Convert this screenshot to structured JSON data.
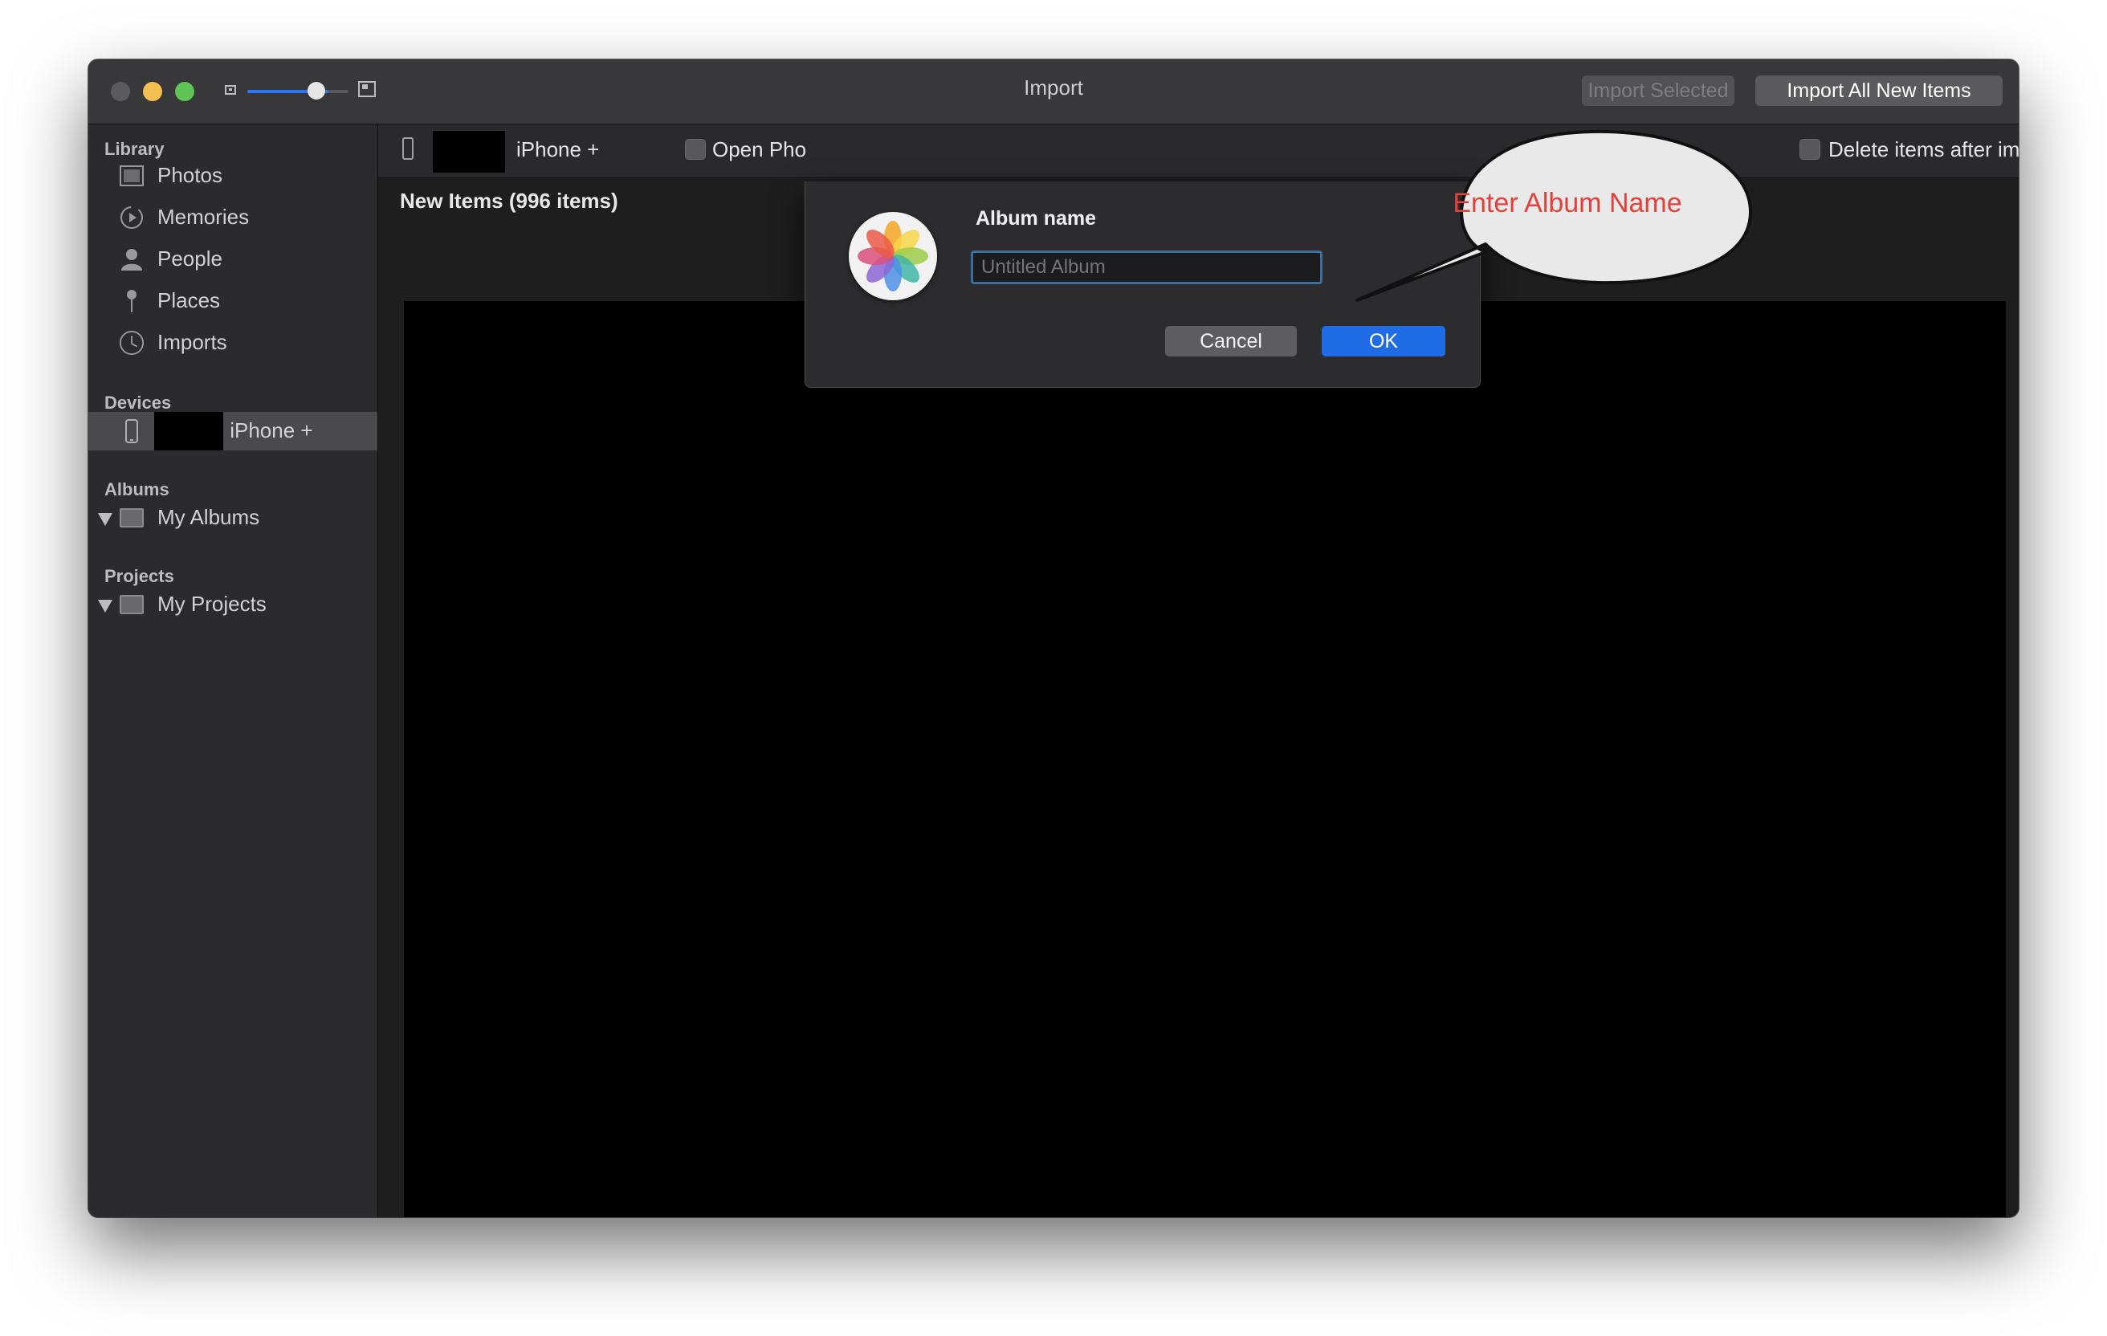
{
  "window": {
    "title": "Import",
    "toolbar": {
      "import_selected_label": "Import Selected",
      "import_all_label": "Import All New Items",
      "thumbnail_size_percent": 80
    }
  },
  "sidebar": {
    "sections": {
      "library": "Library",
      "devices": "Devices",
      "albums": "Albums",
      "projects": "Projects"
    },
    "library_items": [
      {
        "label": "Photos",
        "icon": "photos-icon"
      },
      {
        "label": "Memories",
        "icon": "memories-icon"
      },
      {
        "label": "People",
        "icon": "people-icon"
      },
      {
        "label": "Places",
        "icon": "places-icon"
      },
      {
        "label": "Imports",
        "icon": "imports-icon"
      }
    ],
    "device": {
      "label": "s iPhone +",
      "icon": "iphone-icon"
    },
    "albums_item": {
      "label": "My Albums",
      "icon": "folder-icon"
    },
    "projects_item": {
      "label": "My Projects",
      "icon": "folder-icon"
    }
  },
  "import_bar": {
    "device_label": "iPhone +",
    "open_photos_label": "Open Pho",
    "delete_after_label": "Delete items after import"
  },
  "content": {
    "section_title": "New Items (996 items)"
  },
  "dialog": {
    "title": "Album name",
    "input_placeholder": "Untitled Album",
    "input_value": "",
    "cancel_label": "Cancel",
    "ok_label": "OK"
  },
  "annotation": {
    "text": "Enter Album Name",
    "color": "#e53f3a"
  },
  "colors": {
    "accent": "#1f6ce6",
    "window_bg": "#1e1e1e",
    "sidebar_bg": "#2b2b2d"
  }
}
